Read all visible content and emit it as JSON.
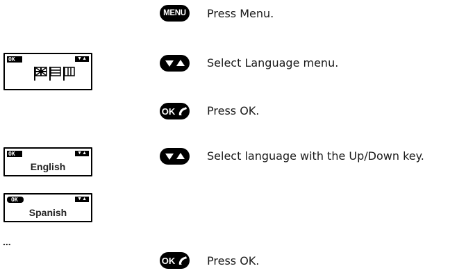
{
  "steps": [
    {
      "button": "MENU",
      "text": "Press Menu."
    },
    {
      "button": "up-down-arrows",
      "text": "Select Language menu."
    },
    {
      "button": "OK",
      "text": "Press OK."
    },
    {
      "button": "up-down-arrows",
      "text": "Select language with the Up/Down key."
    },
    {
      "button": "OK",
      "text": "Press OK."
    }
  ],
  "display": {
    "ok_label": "OK",
    "language_1": "English",
    "language_2": "Spanish"
  },
  "ellipsis": "...",
  "colors": {
    "button": "#000000",
    "text": "#1a1a1a"
  }
}
